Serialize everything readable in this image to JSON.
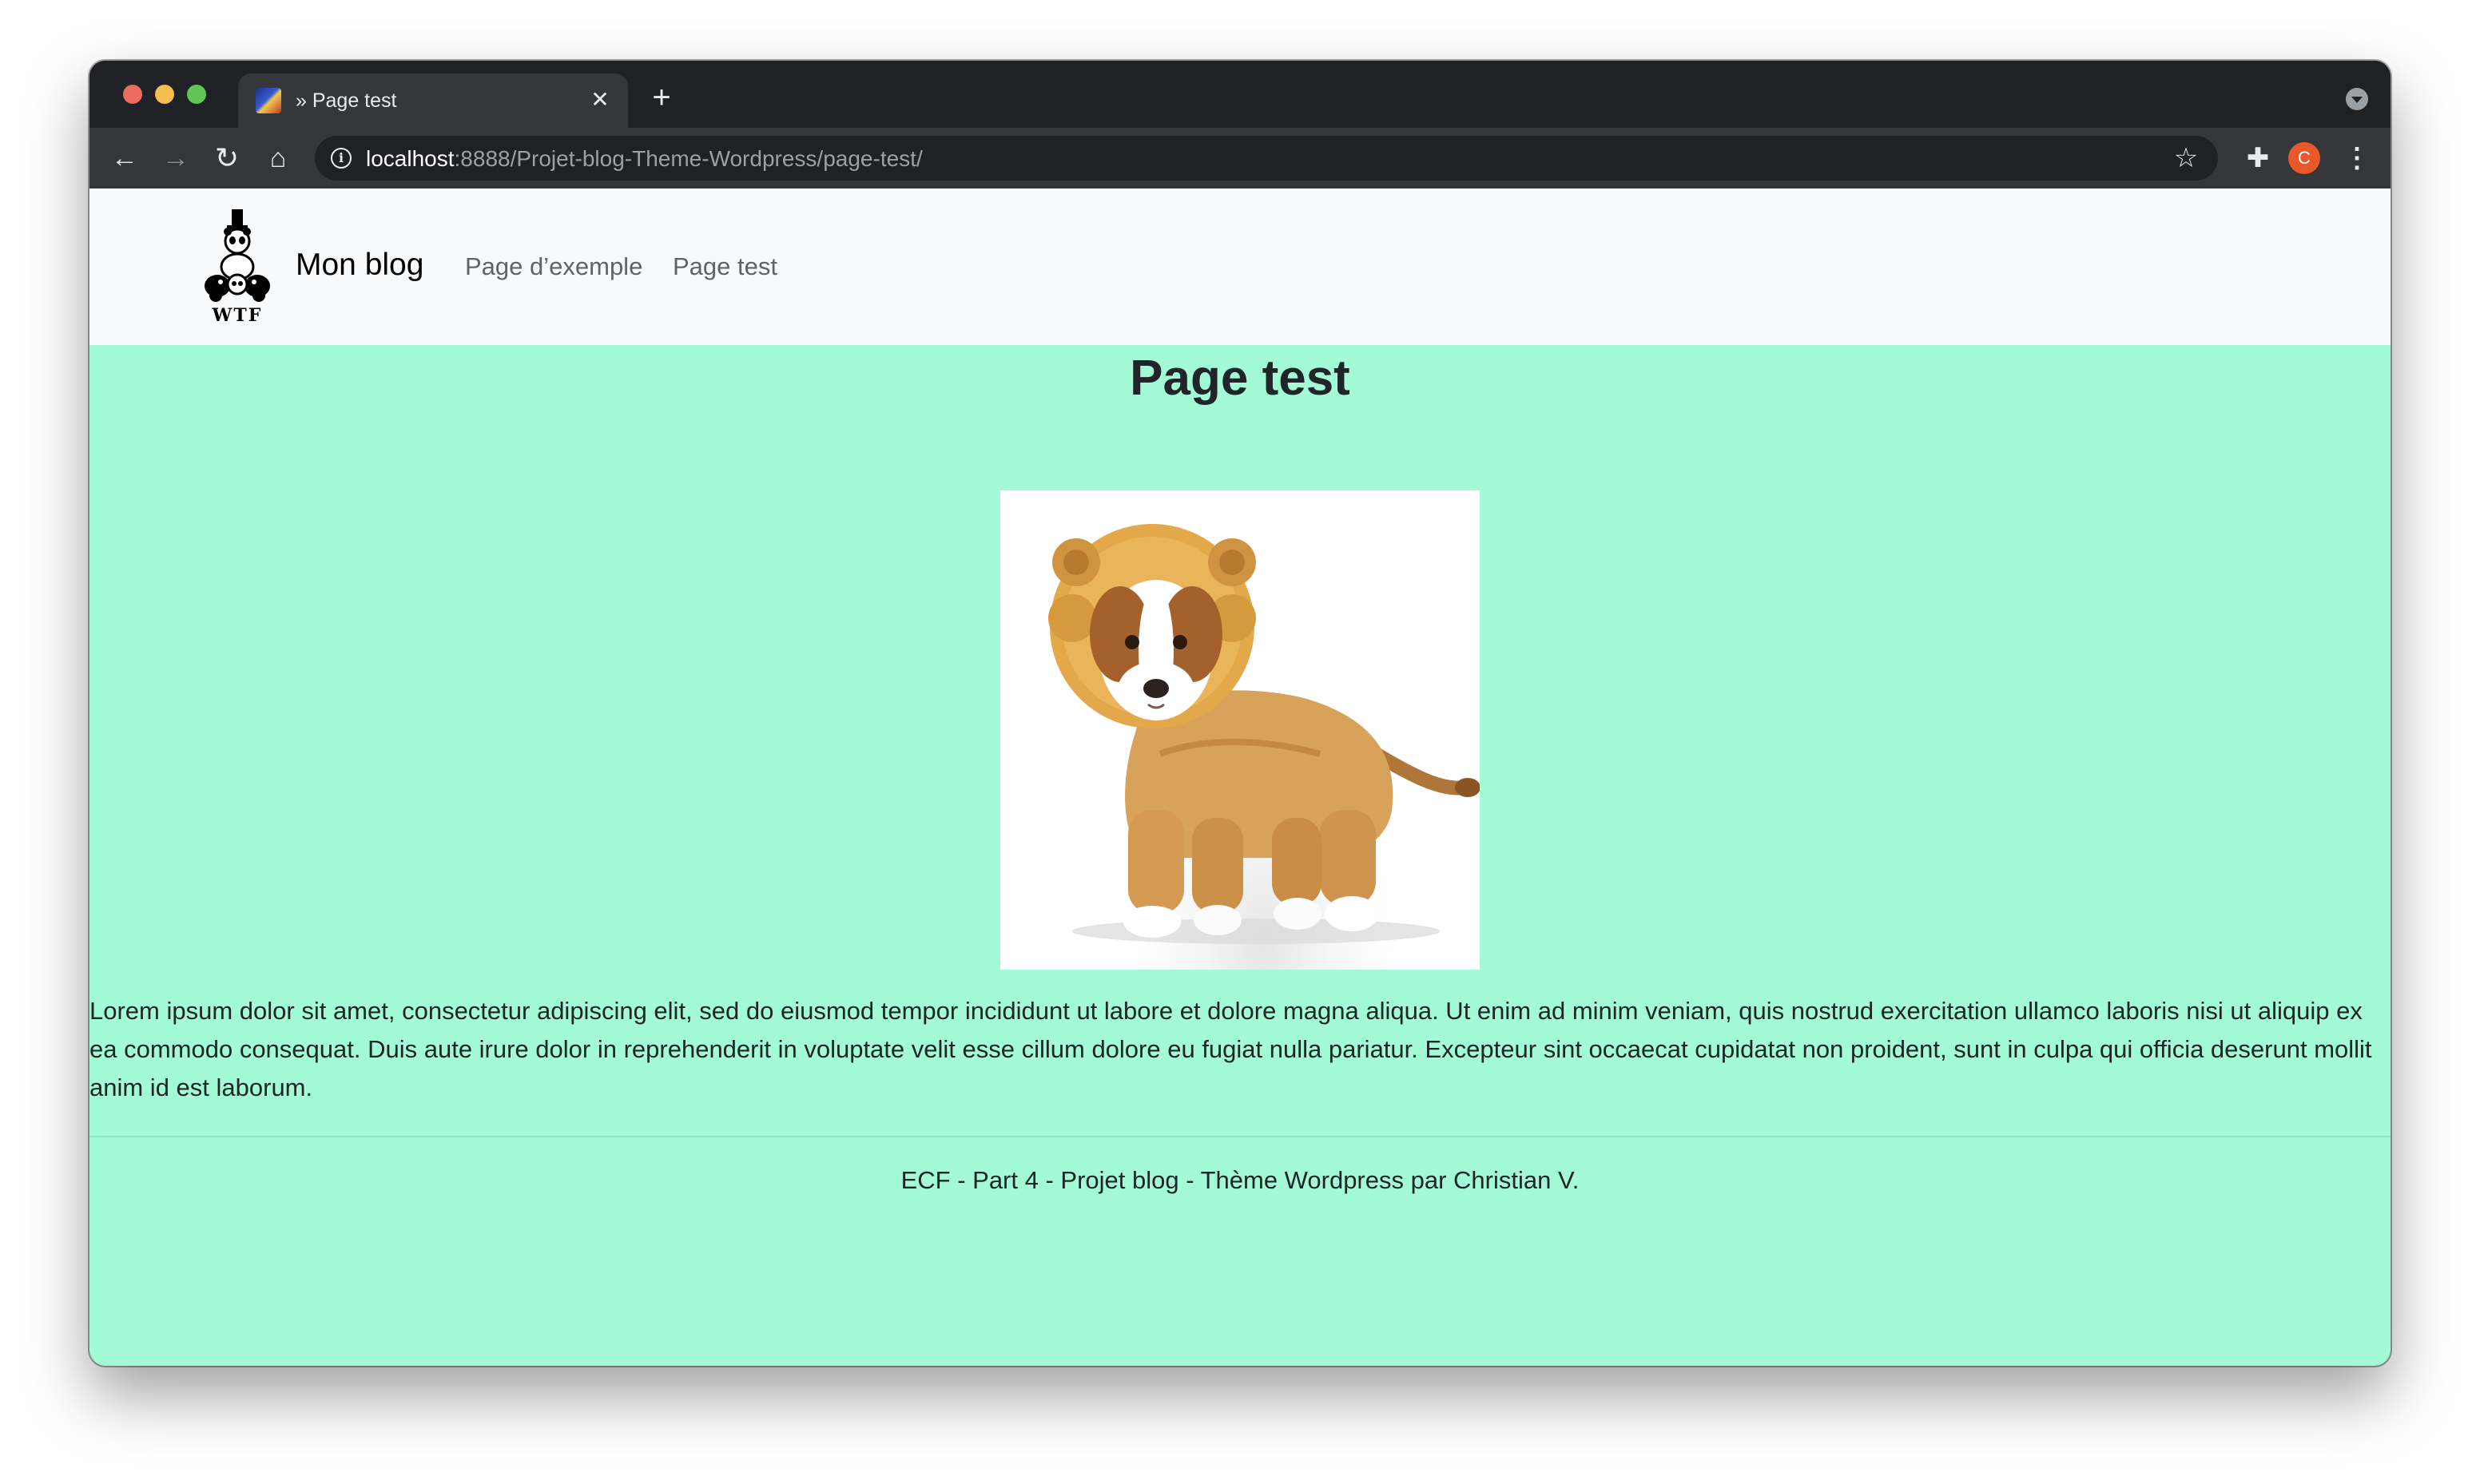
{
  "browser": {
    "tab": {
      "title": "» Page test",
      "close_glyph": "✕"
    },
    "new_tab_glyph": "+",
    "url": {
      "host": "localhost",
      "path": ":8888/Projet-blog-Theme-Wordpress/page-test/"
    },
    "icons": {
      "back": "←",
      "forward": "→",
      "reload": "↻",
      "home": "⌂",
      "info": "i",
      "star": "☆",
      "extensions": "✚",
      "menu": "⋮"
    },
    "profile_initial": "C",
    "colors": {
      "frame": "#202124",
      "toolbar": "#35363a",
      "avatar": "#e8582b"
    }
  },
  "site": {
    "logo": {
      "text": "WTF"
    },
    "brand": "Mon blog",
    "nav": [
      {
        "label": "Page d’exemple"
      },
      {
        "label": "Page test"
      }
    ],
    "colors": {
      "background": "#a2fad6",
      "navbar": "#f8f9fa"
    }
  },
  "page": {
    "title": "Page test",
    "image": {
      "subject": "puppy-in-lion-costume"
    },
    "paragraph": "Lorem ipsum dolor sit amet, consectetur adipiscing elit, sed do eiusmod tempor incididunt ut labore et dolore magna aliqua. Ut enim ad minim veniam, quis nostrud exercitation ullamco laboris nisi ut aliquip ex ea commodo consequat. Duis aute irure dolor in reprehenderit in voluptate velit esse cillum dolore eu fugiat nulla pariatur. Excepteur sint occaecat cupidatat non proident, sunt in culpa qui officia deserunt mollit anim id est laborum."
  },
  "footer": {
    "text": "ECF - Part 4 - Projet blog - Thème Wordpress par Christian V."
  }
}
